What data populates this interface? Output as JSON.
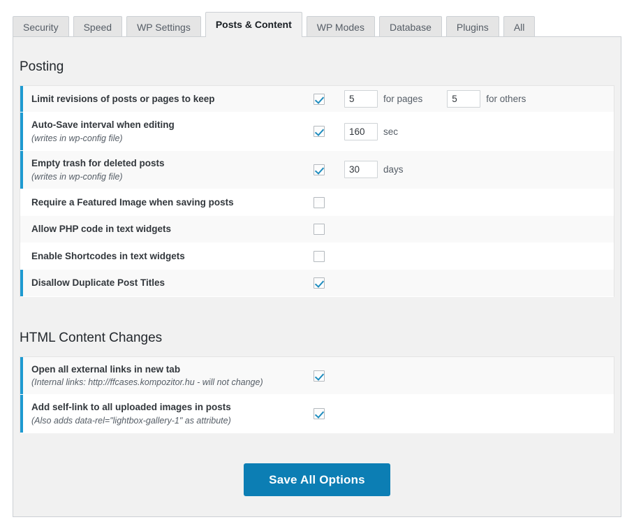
{
  "tabs": [
    {
      "label": "Security",
      "active": false
    },
    {
      "label": "Speed",
      "active": false
    },
    {
      "label": "WP Settings",
      "active": false
    },
    {
      "label": "Posts & Content",
      "active": true
    },
    {
      "label": "WP Modes",
      "active": false
    },
    {
      "label": "Database",
      "active": false
    },
    {
      "label": "Plugins",
      "active": false
    },
    {
      "label": "All",
      "active": false
    }
  ],
  "sections": [
    {
      "title": "Posting",
      "rows": [
        {
          "title": "Limit revisions of posts or pages to keep",
          "sub": "",
          "checked": true,
          "fields": [
            {
              "value": "5",
              "unit": "for pages"
            },
            {
              "value": "5",
              "unit": "for others"
            }
          ]
        },
        {
          "title": "Auto-Save interval when editing",
          "sub": "(writes in wp-config file)",
          "checked": true,
          "fields": [
            {
              "value": "160",
              "unit": "sec"
            }
          ]
        },
        {
          "title": "Empty trash for deleted posts",
          "sub": "(writes in wp-config file)",
          "checked": true,
          "fields": [
            {
              "value": "30",
              "unit": "days"
            }
          ]
        },
        {
          "title": "Require a Featured Image when saving posts",
          "sub": "",
          "checked": false,
          "fields": []
        },
        {
          "title": "Allow PHP code in text widgets",
          "sub": "",
          "checked": false,
          "fields": []
        },
        {
          "title": "Enable Shortcodes in text widgets",
          "sub": "",
          "checked": false,
          "fields": []
        },
        {
          "title": "Disallow Duplicate Post Titles",
          "sub": "",
          "checked": true,
          "fields": []
        }
      ]
    },
    {
      "title": "HTML Content Changes",
      "rows": [
        {
          "title": "Open all external links in new tab",
          "sub": "(Internal links: http://ffcases.kompozitor.hu - will not change)",
          "checked": true,
          "fields": []
        },
        {
          "title": "Add self-link to all uploaded images in posts",
          "sub": "(Also adds data-rel=\"lightbox-gallery-1\" as attribute)",
          "checked": true,
          "fields": []
        }
      ]
    }
  ],
  "save_button": {
    "label": "Save All Options"
  },
  "colors": {
    "accent": "#1e9ad1",
    "button": "#0c7eb4",
    "checkmark": "#1e8cbe",
    "panel_bg": "#f1f1f1"
  }
}
